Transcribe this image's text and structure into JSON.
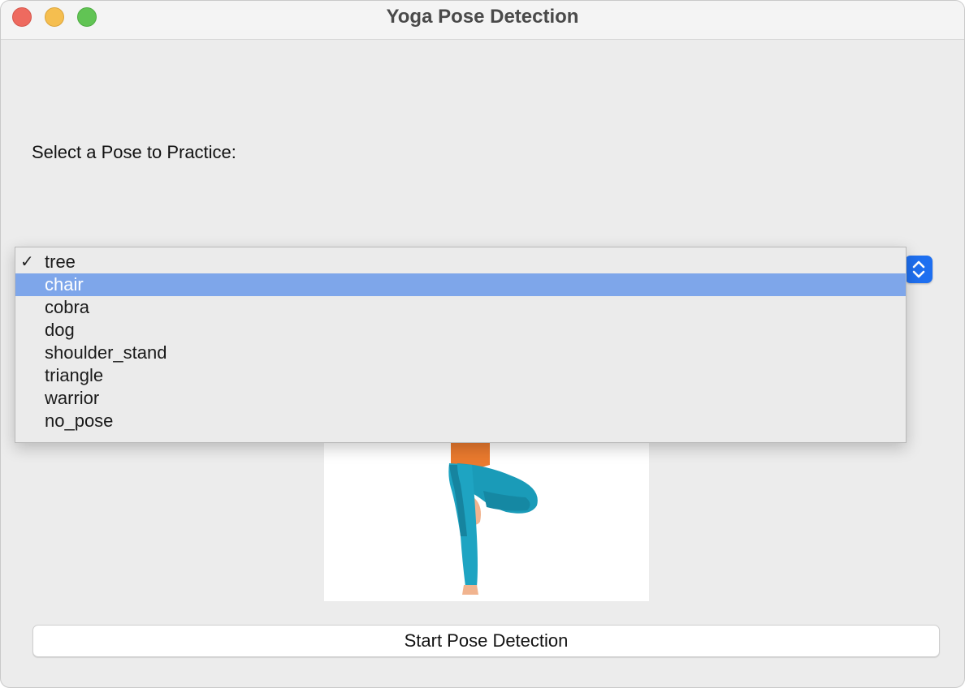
{
  "window": {
    "title": "Yoga Pose Detection"
  },
  "form": {
    "prompt_label": "Select a Pose to Practice:"
  },
  "pose_select": {
    "selected_value": "tree",
    "highlighted_value": "chair",
    "check_glyph": "✓",
    "options": [
      {
        "label": "tree",
        "checked": true,
        "highlighted": false
      },
      {
        "label": "chair",
        "checked": false,
        "highlighted": true
      },
      {
        "label": "cobra",
        "checked": false,
        "highlighted": false
      },
      {
        "label": "dog",
        "checked": false,
        "highlighted": false
      },
      {
        "label": "shoulder_stand",
        "checked": false,
        "highlighted": false
      },
      {
        "label": "triangle",
        "checked": false,
        "highlighted": false
      },
      {
        "label": "warrior",
        "checked": false,
        "highlighted": false
      },
      {
        "label": "no_pose",
        "checked": false,
        "highlighted": false
      }
    ],
    "stepper_icon": "up-down-chevron-icon"
  },
  "preview": {
    "image_description_icon": "tree-pose-figure"
  },
  "actions": {
    "start_label": "Start Pose Detection"
  },
  "colors": {
    "accent": "#1e6ff0",
    "highlight": "#7ea6ea",
    "legs": "#1a9bb8",
    "torso": "#ea7a2e"
  }
}
